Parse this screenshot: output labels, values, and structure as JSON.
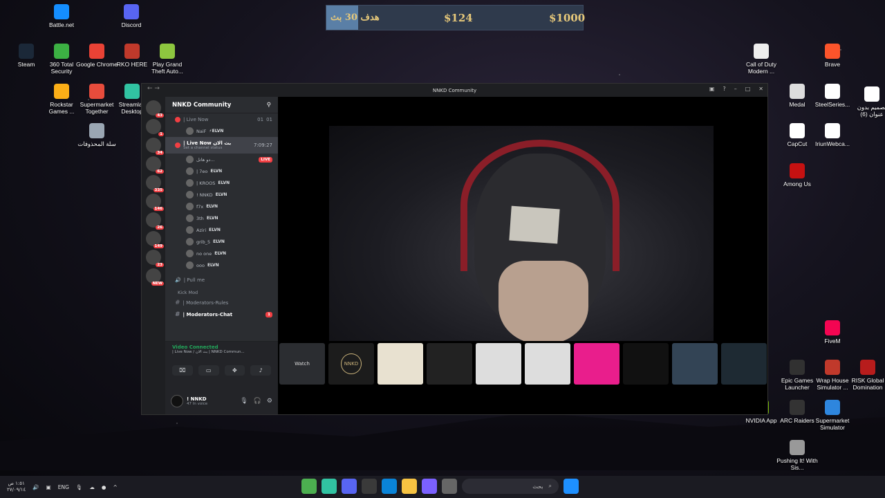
{
  "desktop_icons": [
    {
      "label": "Battle.net",
      "color": "#148eff"
    },
    {
      "label": "Discord",
      "color": "#5865f2"
    },
    {
      "label": "Steam",
      "color": "#1b2838"
    },
    {
      "label": "360 Total Security",
      "color": "#3cb043"
    },
    {
      "label": "Google Chrome",
      "color": "#e94235"
    },
    {
      "label": "RKO HERE",
      "color": "#c0392b"
    },
    {
      "label": "Play Grand Theft Auto...",
      "color": "#8dc63f"
    },
    {
      "label": "Rockstar Games ...",
      "color": "#fcaf17"
    },
    {
      "label": "Supermarket Together",
      "color": "#e74c3c"
    },
    {
      "label": "Streamlab Desktop",
      "color": "#31c3a2"
    },
    {
      "label": "سلة المحذوفات",
      "color": "#9aa6b3"
    },
    {
      "label": "Call of Duty Modern ...",
      "color": "#eeeeee"
    },
    {
      "label": "Brave",
      "color": "#fb542b"
    },
    {
      "label": "Medal",
      "color": "#dddddd"
    },
    {
      "label": "SteelSeries...",
      "color": "#ffffff"
    },
    {
      "label": "تصميم بدون عنوان (6)",
      "color": "#ffffff"
    },
    {
      "label": "CapCut",
      "color": "#ffffff"
    },
    {
      "label": "IriunWebca...",
      "color": "#ffffff"
    },
    {
      "label": "Among Us",
      "color": "#c51111"
    },
    {
      "label": "FiveM",
      "color": "#f40552"
    },
    {
      "label": "Epic Games Launcher",
      "color": "#313131"
    },
    {
      "label": "Wrap House Simulator ...",
      "color": "#c0392b"
    },
    {
      "label": "RISK Global Domination",
      "color": "#b71c1c"
    },
    {
      "label": "NVIDIA App",
      "color": "#76b900"
    },
    {
      "label": "ARC Raiders",
      "color": "#333333"
    },
    {
      "label": "Supermarket Simulator",
      "color": "#2e86de"
    },
    {
      "label": "Pushing It! With Sis...",
      "color": "#999999"
    }
  ],
  "goal_banner": {
    "goal": "هدف 30 بث",
    "mid": "$124",
    "target": "$1000"
  },
  "window": {
    "title": "NNKD Community"
  },
  "server": {
    "name": "NNKD Community"
  },
  "server_badges": [
    "43",
    "1",
    "34",
    "62",
    "335",
    "146",
    "26",
    "149",
    "23",
    "NEW"
  ],
  "channels": {
    "live_now_1": {
      "label": "| Live Now",
      "count1": "01",
      "count2": "01"
    },
    "live_now_1_user": "NaiF",
    "live_now_2": {
      "label": "| Live Now بث الان",
      "timer": "7:09:27",
      "status": "Set a channel status"
    },
    "users": [
      {
        "name": "دو هاتل...",
        "tag": "",
        "live": "LIVE"
      },
      {
        "name": "| 7eo",
        "tag": "ELVN",
        "live": ""
      },
      {
        "name": "| KROOS",
        "tag": "ELVN",
        "live": ""
      },
      {
        "name": "! NNKD",
        "tag": "ELVN",
        "live": ""
      },
      {
        "name": "f7x",
        "tag": "ELVN",
        "live": ""
      },
      {
        "name": "3th",
        "tag": "ELVN",
        "live": ""
      },
      {
        "name": "Aziri",
        "tag": "ELVN",
        "live": ""
      },
      {
        "name": "grib_5",
        "tag": "ELVN",
        "live": ""
      },
      {
        "name": "no one",
        "tag": "ELVN",
        "live": ""
      },
      {
        "name": "ooo",
        "tag": "ELVN",
        "live": ""
      }
    ],
    "pull_me": "| Pull me",
    "category": "Kick Mod",
    "rules": "| Moderators-Rules",
    "chat": "| Moderators-Chat",
    "chat_badge": "1"
  },
  "voice": {
    "title": "Video Connected",
    "sub": "| Live Now / بث الان | NNKD Commun..."
  },
  "user": {
    "name": "! NNKD",
    "status": "47 In voice"
  },
  "tiles": [
    {
      "label": "Watch",
      "color": "#2b2d31"
    },
    {
      "label": "NNKD",
      "color": "#1c1c1c"
    },
    {
      "label": "",
      "color": "#e8e1d0"
    },
    {
      "label": "",
      "color": "#222222"
    },
    {
      "label": "",
      "color": "#dddddd"
    },
    {
      "label": "",
      "color": "#dddddd"
    },
    {
      "label": "",
      "color": "#e91e8c"
    },
    {
      "label": "",
      "color": "#111111"
    },
    {
      "label": "",
      "color": "#334455"
    },
    {
      "label": "",
      "color": "#1e2a33"
    }
  ],
  "taskbar": {
    "time": "١:٥١ ص",
    "date": "٢٧/٠٩/١٤",
    "lang": "ENG",
    "search": "بحث"
  }
}
